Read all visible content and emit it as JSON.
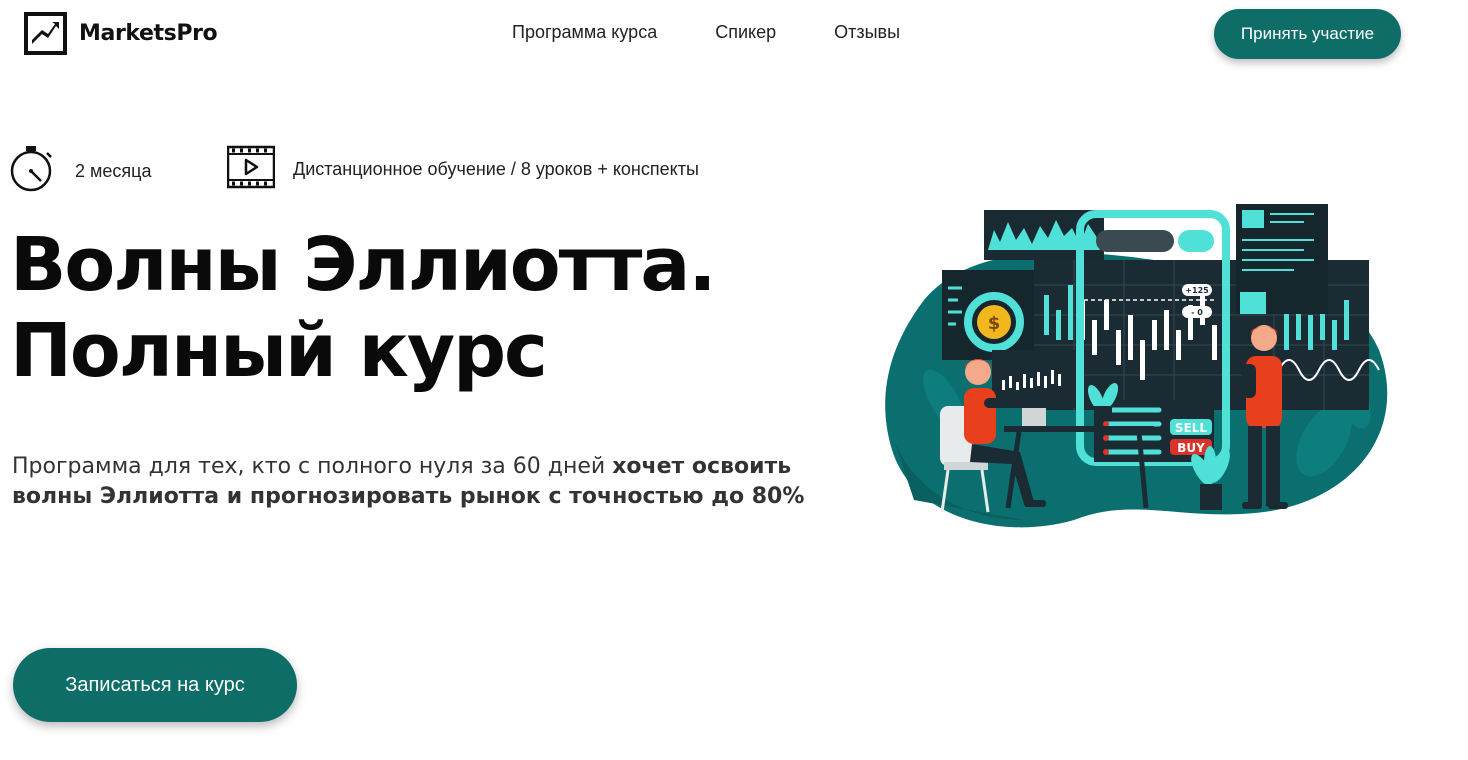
{
  "header": {
    "logo_text": "MarketsPro",
    "nav": [
      "Программа курса",
      "Спикер",
      "Отзывы"
    ],
    "cta_label": "Принять участие"
  },
  "features": [
    {
      "icon": "stopwatch-icon",
      "text": "2 месяца"
    },
    {
      "icon": "video-film-icon",
      "text": "Дистанционное обучение / 8 уроков + конспекты"
    }
  ],
  "hero": {
    "title_line1": "Волны Эллиотта.",
    "title_line2": "Полный курс",
    "subtitle_regular": "Программа для тех, кто с полного нуля  за 60 дней ",
    "subtitle_bold": "хочет освоить волны Эллиотта и прогнозировать рынок с точностью до 80%",
    "cta_label": "Записаться на курс"
  },
  "illustration": {
    "sell_label": "SELL",
    "buy_label": "BUY",
    "tag_plus": "+125",
    "tag_zero": "- 0"
  },
  "colors": {
    "accent": "#0e6e67",
    "teal_light": "#4fe0d8",
    "orange": "#e8401c",
    "red": "#d9342b",
    "text": "#111111"
  }
}
